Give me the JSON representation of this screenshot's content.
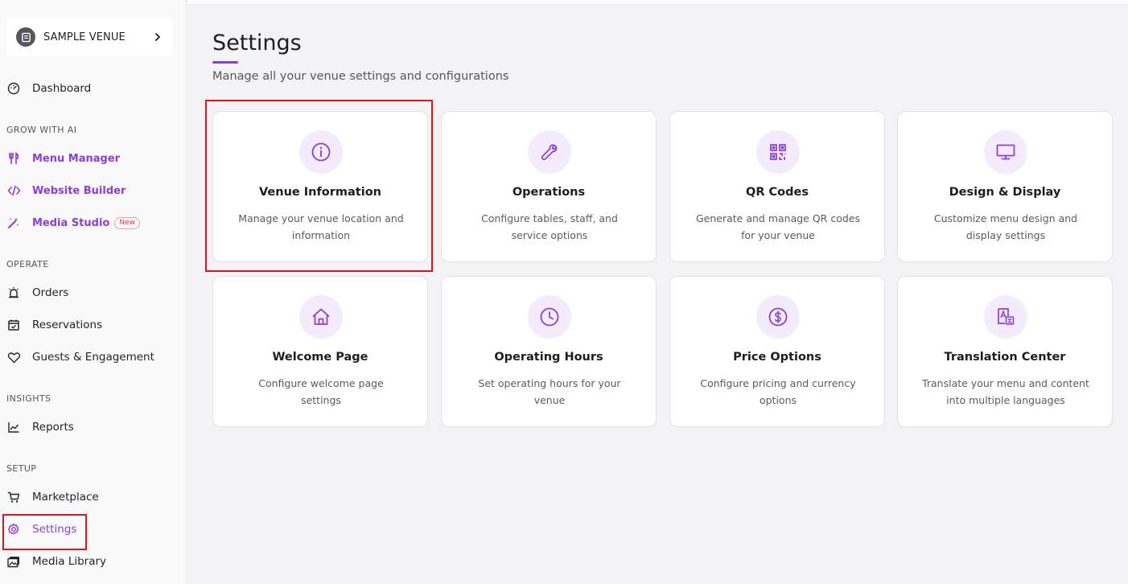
{
  "venue": {
    "name": "SAMPLE VENUE"
  },
  "nav": {
    "dashboard": "Dashboard",
    "section_ai": "GROW WITH AI",
    "menu_manager": "Menu Manager",
    "website_builder": "Website Builder",
    "media_studio": "Media Studio",
    "new_badge": "New",
    "section_operate": "OPERATE",
    "orders": "Orders",
    "reservations": "Reservations",
    "guests": "Guests & Engagement",
    "section_insights": "INSIGHTS",
    "reports": "Reports",
    "section_setup": "SETUP",
    "marketplace": "Marketplace",
    "settings": "Settings",
    "media_library": "Media Library"
  },
  "page": {
    "title": "Settings",
    "subtitle": "Manage all your venue settings and configurations"
  },
  "cards": [
    {
      "title": "Venue Information",
      "desc": "Manage your venue location and information",
      "icon": "info-icon"
    },
    {
      "title": "Operations",
      "desc": "Configure tables, staff, and service options",
      "icon": "wrench-icon"
    },
    {
      "title": "QR Codes",
      "desc": "Generate and manage QR codes for your venue",
      "icon": "qr-code-icon"
    },
    {
      "title": "Design & Display",
      "desc": "Customize menu design and display settings",
      "icon": "monitor-icon"
    },
    {
      "title": "Welcome Page",
      "desc": "Configure welcome page settings",
      "icon": "home-icon"
    },
    {
      "title": "Operating Hours",
      "desc": "Set operating hours for your venue",
      "icon": "clock-icon"
    },
    {
      "title": "Price Options",
      "desc": "Configure pricing and currency options",
      "icon": "dollar-icon"
    },
    {
      "title": "Translation Center",
      "desc": "Translate your menu and content into multiple languages",
      "icon": "translate-icon"
    }
  ],
  "colors": {
    "accent": "#8a3fd6",
    "highlight": "#e0141e",
    "icon_bg": "#f4ecfd"
  }
}
